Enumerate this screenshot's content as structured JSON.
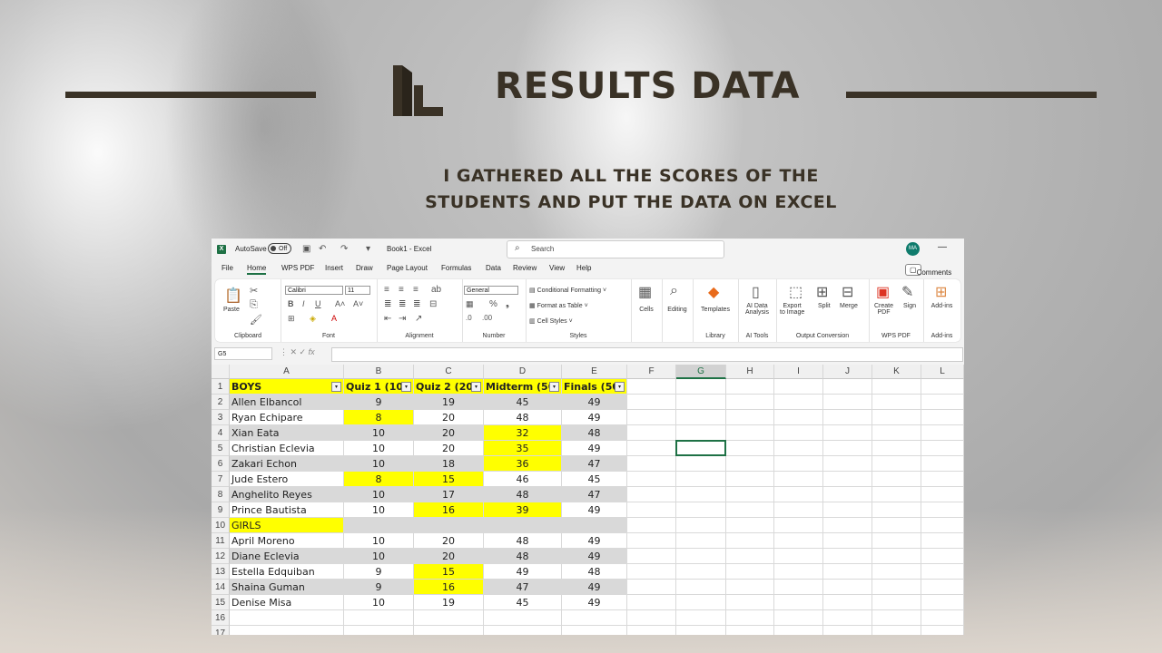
{
  "slide": {
    "title": "RESULTS DATA",
    "subtitle_line1": "I GATHERED ALL THE SCORES OF THE",
    "subtitle_line2": "STUDENTS AND PUT THE DATA ON EXCEL"
  },
  "excel": {
    "autosave_label": "AutoSave",
    "autosave_state": "Off",
    "document_title": "Book1 - Excel",
    "search_placeholder": "Search",
    "user_initials": "MA",
    "tabs": [
      "File",
      "Home",
      "WPS PDF",
      "Insert",
      "Draw",
      "Page Layout",
      "Formulas",
      "Data",
      "Review",
      "View",
      "Help"
    ],
    "active_tab": "Home",
    "comments_label": "Comments",
    "ribbon": {
      "clipboard": {
        "paste": "Paste",
        "label": "Clipboard"
      },
      "font": {
        "name": "Calibri",
        "size": "11",
        "label": "Font"
      },
      "alignment": {
        "label": "Alignment"
      },
      "number": {
        "format": "General",
        "label": "Number"
      },
      "styles": {
        "conditional": "Conditional Formatting",
        "table": "Format as Table",
        "cell_styles": "Cell Styles",
        "label": "Styles"
      },
      "cells": "Cells",
      "editing": "Editing",
      "templates": "Templates",
      "library": "Library",
      "ai_line1": "AI Data",
      "ai_line2": "Analysis",
      "ai_tools": "AI Tools",
      "export_line1": "Export",
      "export_line2": "to Image",
      "split": "Split",
      "merge": "Merge",
      "output_conversion": "Output Conversion",
      "create_line1": "Create",
      "create_line2": "PDF",
      "sign": "Sign",
      "wps_pdf": "WPS PDF",
      "addins": "Add-ins",
      "addins_group": "Add-ins"
    },
    "name_box": "G5",
    "fx": "fx",
    "columns": [
      "A",
      "B",
      "C",
      "D",
      "E",
      "F",
      "G",
      "H",
      "I",
      "J",
      "K",
      "L"
    ],
    "selected_column": "G",
    "headers": [
      "BOYS",
      "Quiz 1 (10)",
      "Quiz 2 (20)",
      "Midterm (50)",
      "Finals (50)"
    ],
    "rows": [
      {
        "n": "2",
        "name": "Allen Elbancol",
        "q1": "9",
        "q2": "19",
        "mid": "45",
        "fin": "49"
      },
      {
        "n": "3",
        "name": "Ryan Echipare",
        "q1": "8",
        "q2": "20",
        "mid": "48",
        "fin": "49"
      },
      {
        "n": "4",
        "name": "Xian Eata",
        "q1": "10",
        "q2": "20",
        "mid": "32",
        "fin": "48"
      },
      {
        "n": "5",
        "name": "Christian Eclevia",
        "q1": "10",
        "q2": "20",
        "mid": "35",
        "fin": "49"
      },
      {
        "n": "6",
        "name": "Zakari Echon",
        "q1": "10",
        "q2": "18",
        "mid": "36",
        "fin": "47"
      },
      {
        "n": "7",
        "name": "Jude Estero",
        "q1": "8",
        "q2": "15",
        "mid": "46",
        "fin": "45"
      },
      {
        "n": "8",
        "name": "Anghelito Reyes",
        "q1": "10",
        "q2": "17",
        "mid": "48",
        "fin": "47"
      },
      {
        "n": "9",
        "name": "Prince Bautista",
        "q1": "10",
        "q2": "16",
        "mid": "39",
        "fin": "49"
      },
      {
        "n": "10",
        "name": "GIRLS",
        "q1": "",
        "q2": "",
        "mid": "",
        "fin": ""
      },
      {
        "n": "11",
        "name": "April Moreno",
        "q1": "10",
        "q2": "20",
        "mid": "48",
        "fin": "49"
      },
      {
        "n": "12",
        "name": "Diane Eclevia",
        "q1": "10",
        "q2": "20",
        "mid": "48",
        "fin": "49"
      },
      {
        "n": "13",
        "name": "Estella Edquiban",
        "q1": "9",
        "q2": "15",
        "mid": "49",
        "fin": "48"
      },
      {
        "n": "14",
        "name": "Shaina Guman",
        "q1": "9",
        "q2": "16",
        "mid": "47",
        "fin": "49"
      },
      {
        "n": "15",
        "name": "Denise Misa",
        "q1": "10",
        "q2": "19",
        "mid": "45",
        "fin": "49"
      }
    ],
    "empty_rows": [
      "16",
      "17"
    ],
    "highlight_color": "#ffff00",
    "band_color": "#d9d9d9",
    "highlights": [
      [
        "3",
        "q1"
      ],
      [
        "4",
        "mid"
      ],
      [
        "5",
        "mid"
      ],
      [
        "6",
        "mid"
      ],
      [
        "7",
        "q1"
      ],
      [
        "7",
        "q2"
      ],
      [
        "9",
        "q2"
      ],
      [
        "9",
        "mid"
      ],
      [
        "10",
        "name"
      ],
      [
        "13",
        "q2"
      ],
      [
        "14",
        "q2"
      ]
    ]
  }
}
